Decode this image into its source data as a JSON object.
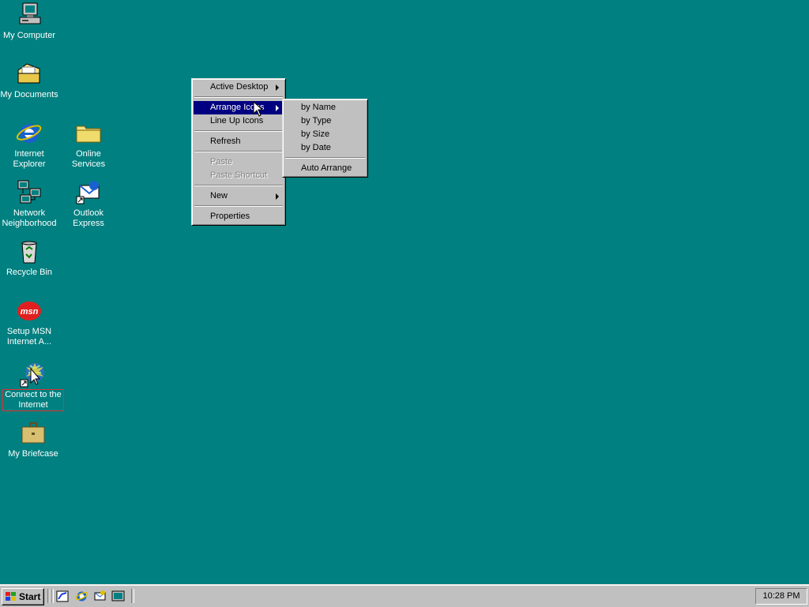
{
  "desktop": {
    "icons": [
      {
        "label_l1": "My Computer",
        "label_l2": "",
        "icon": "my-computer-icon"
      },
      {
        "label_l1": "My Documents",
        "label_l2": "",
        "icon": "my-documents-icon"
      },
      {
        "label_l1": "Internet",
        "label_l2": "Explorer",
        "icon": "internet-explorer-icon"
      },
      {
        "label_l1": "Online",
        "label_l2": "Services",
        "icon": "online-services-folder-icon"
      },
      {
        "label_l1": "Network",
        "label_l2": "Neighborhood",
        "icon": "network-neighborhood-icon"
      },
      {
        "label_l1": "Outlook",
        "label_l2": "Express",
        "icon": "outlook-express-icon"
      },
      {
        "label_l1": "Recycle Bin",
        "label_l2": "",
        "icon": "recycle-bin-icon"
      },
      {
        "label_l1": "Setup MSN",
        "label_l2": "Internet A...",
        "icon": "msn-icon"
      },
      {
        "label_l1": "Connect to the",
        "label_l2": "Internet",
        "icon": "connect-internet-icon"
      },
      {
        "label_l1": "My Briefcase",
        "label_l2": "",
        "icon": "briefcase-icon"
      }
    ]
  },
  "context_menu": {
    "items": {
      "active_desktop": "Active Desktop",
      "arrange_icons": "Arrange Icons",
      "line_up_icons": "Line Up Icons",
      "refresh": "Refresh",
      "paste": "Paste",
      "paste_shortcut": "Paste Shortcut",
      "new": "New",
      "properties": "Properties"
    }
  },
  "submenu": {
    "items": {
      "by_name": "by Name",
      "by_type": "by Type",
      "by_size": "by Size",
      "by_date": "by Date",
      "auto_arrange": "Auto Arrange"
    }
  },
  "taskbar": {
    "start_label": "Start",
    "clock": "10:28 PM",
    "quick_launch": [
      "show-desktop-icon",
      "ie-quicklaunch-icon",
      "outlook-quicklaunch-icon",
      "channels-icon"
    ]
  },
  "colors": {
    "desktop": "#008080",
    "highlight": "#000080",
    "face": "#c0c0c0"
  }
}
